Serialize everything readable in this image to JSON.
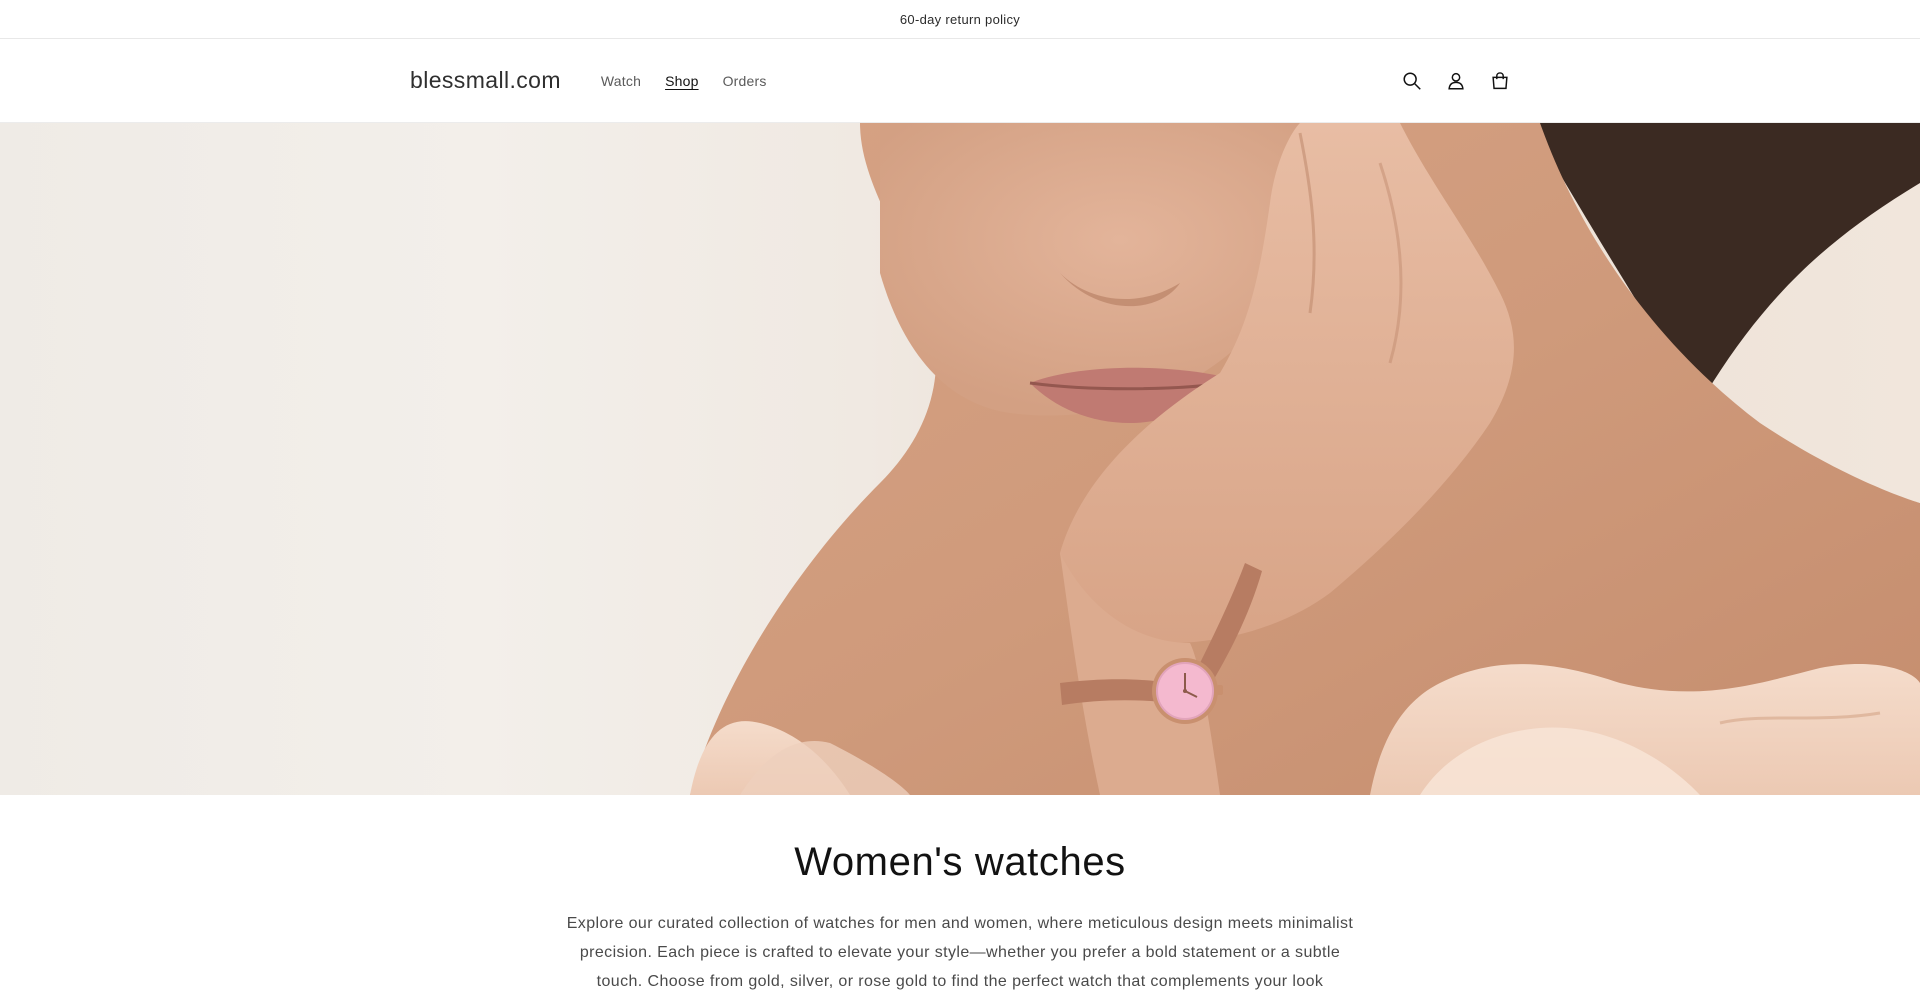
{
  "announcement": {
    "text": "60-day return policy"
  },
  "header": {
    "logo": "blessmall.com",
    "nav": [
      {
        "label": "Watch",
        "active": false
      },
      {
        "label": "Shop",
        "active": true
      },
      {
        "label": "Orders",
        "active": false
      }
    ],
    "icons": [
      "search-icon",
      "account-icon",
      "cart-icon"
    ]
  },
  "hero": {
    "image": "woman-wearing-rose-gold-watch"
  },
  "collection": {
    "title": "Women's watches",
    "description": "Explore our curated collection of watches for men and women, where meticulous design meets minimalist precision. Each piece is crafted to elevate your style—whether you prefer a bold statement or a subtle touch. Choose from gold, silver, or rose gold to find the perfect watch that complements your look effortlessly."
  },
  "colors": {
    "text": "#121212",
    "muted": "#5a5a5a",
    "hero_bg": "#f0ebe5",
    "skin": "#d9a98a",
    "blouse": "#f1d3c0",
    "watch_face": "#f4b9cf"
  }
}
